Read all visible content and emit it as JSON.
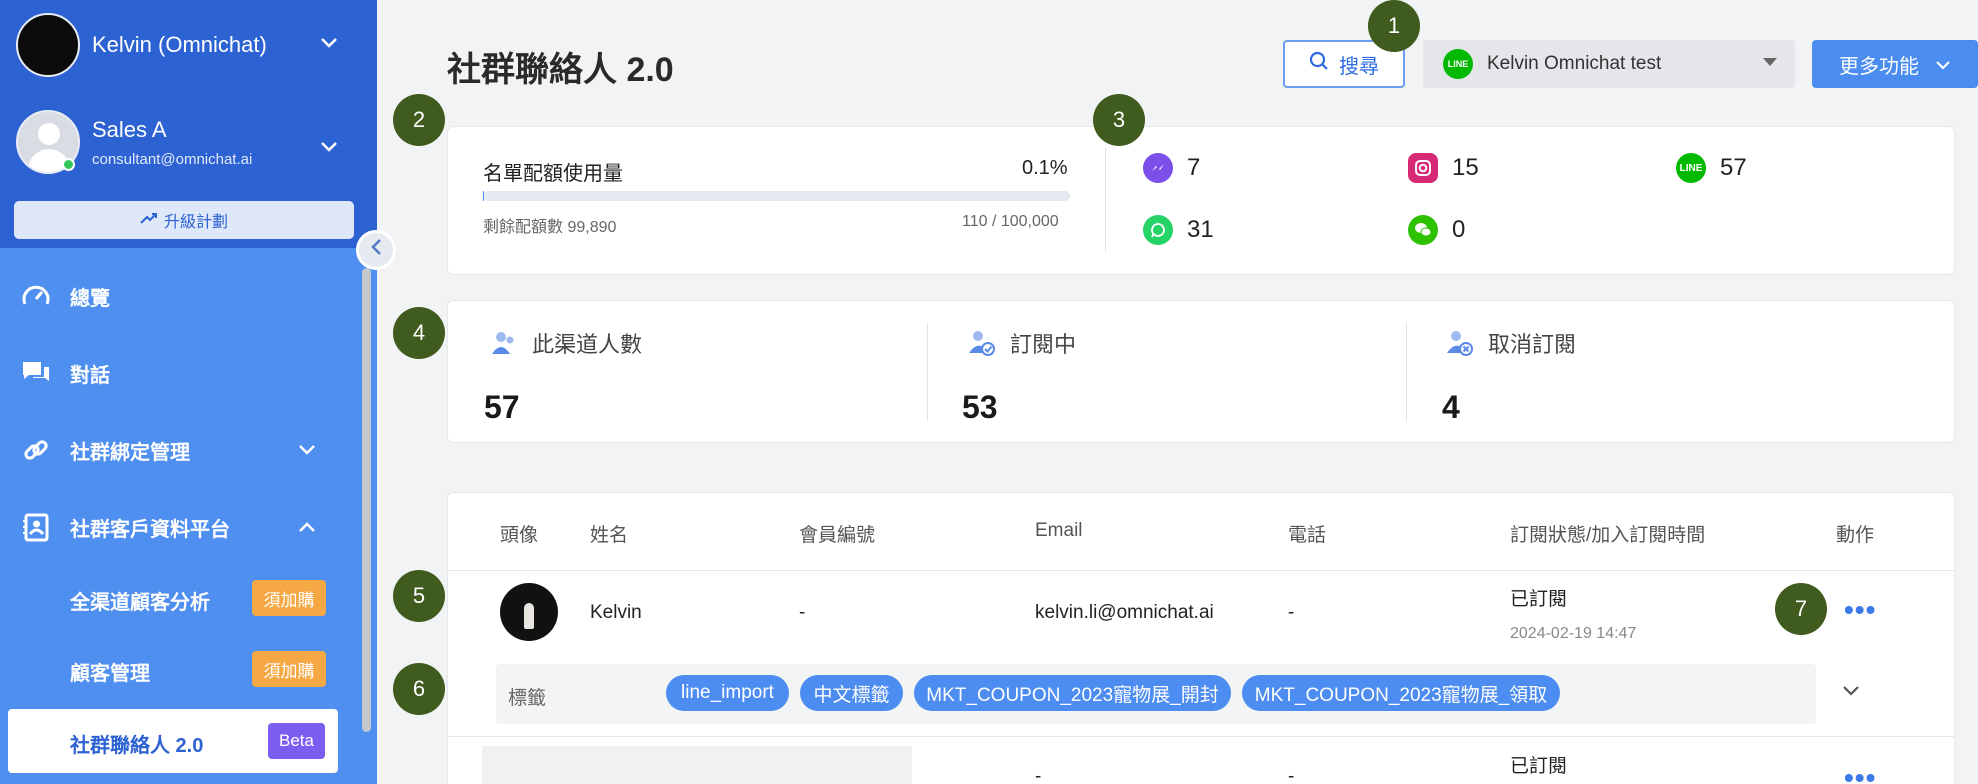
{
  "sidebar": {
    "account_name": "Kelvin (Omnichat)",
    "agent_name": "Sales A",
    "agent_email": "consultant@omnichat.ai",
    "upgrade_label": "升級計劃",
    "nav": [
      {
        "label": "總覽"
      },
      {
        "label": "對話"
      },
      {
        "label": "社群綁定管理"
      },
      {
        "label": "社群客戶資料平台"
      }
    ],
    "subnav": [
      {
        "label": "全渠道顧客分析",
        "badge": "須加購"
      },
      {
        "label": "顧客管理",
        "badge": "須加購"
      },
      {
        "label": "社群聯絡人 2.0",
        "badge": "Beta"
      }
    ]
  },
  "header": {
    "title": "社群聯絡人 2.0",
    "search_label": "搜尋",
    "channel_selected": "Kelvin Omnichat test",
    "channel_icon_text": "LINE",
    "more_label": "更多功能"
  },
  "quota": {
    "label": "名單配額使用量",
    "percent": "0.1%",
    "percent_value": 0.1,
    "remaining": "剩餘配額數 99,890",
    "count": "110 / 100,000"
  },
  "channels": [
    {
      "icon": "messenger-icon",
      "count": "7",
      "color": "#7b4fe8"
    },
    {
      "icon": "instagram-icon",
      "count": "15",
      "color": "#d62976"
    },
    {
      "icon": "line-icon",
      "count": "57",
      "color": "#00b900"
    },
    {
      "icon": "whatsapp-icon",
      "count": "31",
      "color": "#25d366"
    },
    {
      "icon": "wechat-icon",
      "count": "0",
      "color": "#2dc100"
    }
  ],
  "stats": [
    {
      "label": "此渠道人數",
      "value": "57"
    },
    {
      "label": "訂閱中",
      "value": "53"
    },
    {
      "label": "取消訂閱",
      "value": "4"
    }
  ],
  "table": {
    "headers": [
      "頭像",
      "姓名",
      "會員編號",
      "Email",
      "電話",
      "訂閱狀態/加入訂閱時間",
      "動作"
    ],
    "rows": [
      {
        "name": "Kelvin",
        "member_id": "-",
        "email": "kelvin.li@omnichat.ai",
        "phone": "-",
        "status": "已訂閱",
        "time": "2024-02-19 14:47",
        "action": "•••",
        "tags_label": "標籤",
        "tags": [
          "line_import",
          "中文標籤",
          "MKT_COUPON_2023寵物展_開封",
          "MKT_COUPON_2023寵物展_領取"
        ]
      },
      {
        "member_id": "-",
        "phone": "-",
        "status": "已訂閱",
        "action": "•••"
      }
    ]
  },
  "steps": [
    "1",
    "2",
    "3",
    "4",
    "5",
    "6",
    "7"
  ],
  "colors": {
    "sidebar_top": "#2d62d2",
    "sidebar": "#4e8ff0",
    "accent": "#4a8cf0",
    "badge_buy": "#f5a843",
    "badge_beta": "#7b5df0",
    "step_marker": "#3f5b1e"
  }
}
